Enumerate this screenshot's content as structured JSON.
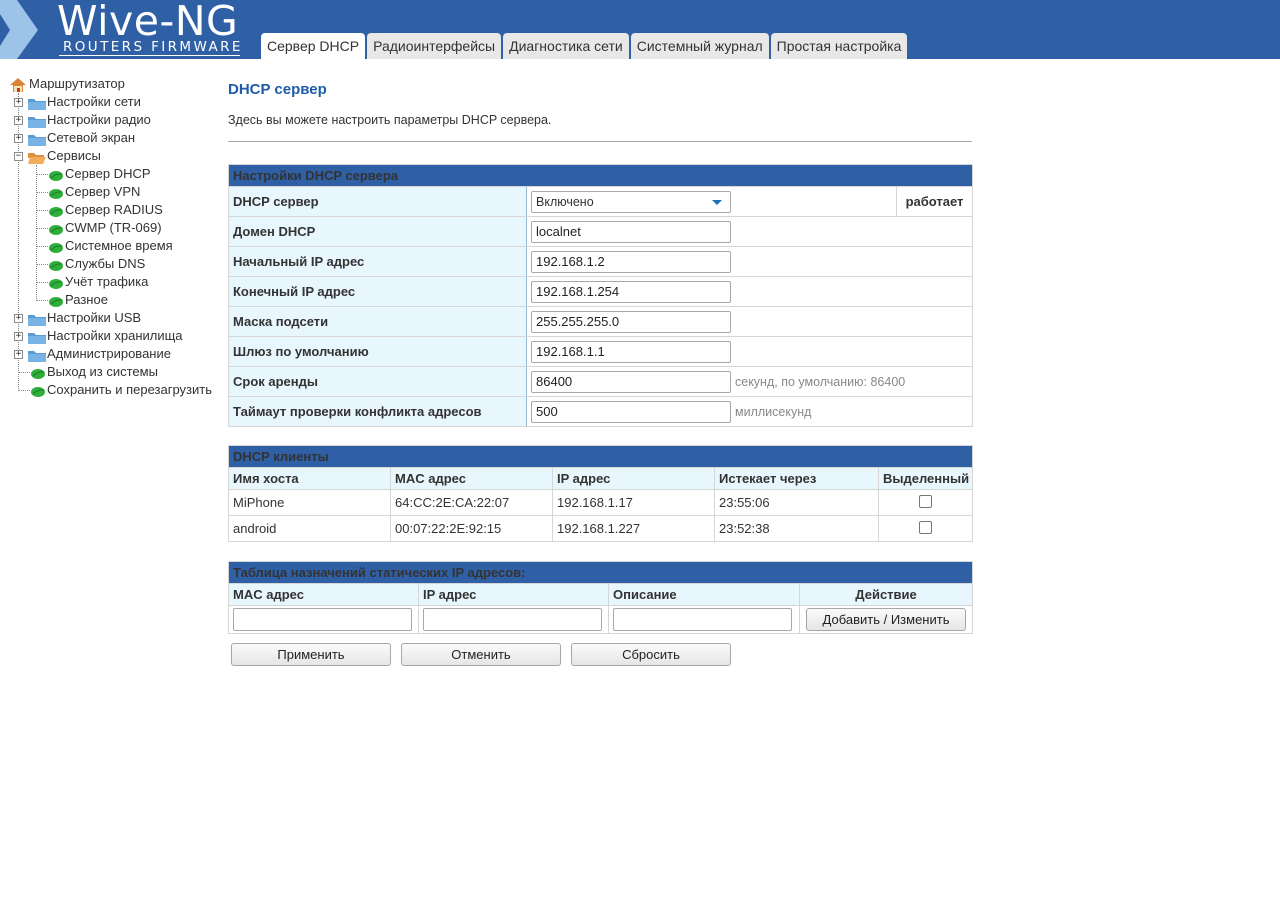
{
  "brand": {
    "title": "Wive-NG",
    "subtitle": "ROUTERS FIRMWARE"
  },
  "colors": {
    "header": "#2f5fa5",
    "accent": "#1d5ba8",
    "status_ok": "#4a9a2a",
    "label_bg": "#e8f6fd"
  },
  "tabs": [
    {
      "label": "Сервер DHCP",
      "active": true
    },
    {
      "label": "Радиоинтерфейсы",
      "active": false
    },
    {
      "label": "Диагностика сети",
      "active": false
    },
    {
      "label": "Системный журнал",
      "active": false
    },
    {
      "label": "Простая настройка",
      "active": false
    }
  ],
  "tree": {
    "root": {
      "label": "Маршрутизатор",
      "icon": "house-icon"
    },
    "items": [
      {
        "label": "Настройки сети",
        "icon": "folder-icon",
        "expanded": false
      },
      {
        "label": "Настройки радио",
        "icon": "folder-icon",
        "expanded": false
      },
      {
        "label": "Сетевой экран",
        "icon": "folder-icon",
        "expanded": false
      },
      {
        "label": "Сервисы",
        "icon": "folder-open-icon",
        "expanded": true,
        "children": [
          {
            "label": "Сервер DHCP"
          },
          {
            "label": "Сервер VPN"
          },
          {
            "label": "Сервер RADIUS"
          },
          {
            "label": "CWMP (TR-069)"
          },
          {
            "label": "Системное время"
          },
          {
            "label": "Службы DNS"
          },
          {
            "label": "Учёт трафика"
          },
          {
            "label": "Разное"
          }
        ]
      },
      {
        "label": "Настройки USB",
        "icon": "folder-icon",
        "expanded": false
      },
      {
        "label": "Настройки хранилища",
        "icon": "folder-icon",
        "expanded": false
      },
      {
        "label": "Администрирование",
        "icon": "folder-icon",
        "expanded": false
      },
      {
        "label": "Выход из системы",
        "icon": "leaf-icon"
      },
      {
        "label": "Сохранить и перезагрузить",
        "icon": "leaf-icon"
      }
    ]
  },
  "page": {
    "title": "DHCP сервер",
    "description": "Здесь вы можете настроить параметры DHCP сервера."
  },
  "settings": {
    "title": "Настройки DHCP сервера",
    "dhcp_server": {
      "label": "DHCP сервер",
      "value": "Включено",
      "status": "работает"
    },
    "domain": {
      "label": "Домен DHCP",
      "value": "localnet"
    },
    "start_ip": {
      "label": "Начальный IP адрес",
      "value": "192.168.1.2"
    },
    "end_ip": {
      "label": "Конечный IP адрес",
      "value": "192.168.1.254"
    },
    "netmask": {
      "label": "Маска подсети",
      "value": "255.255.255.0"
    },
    "gateway": {
      "label": "Шлюз по умолчанию",
      "value": "192.168.1.1"
    },
    "lease": {
      "label": "Срок аренды",
      "value": "86400",
      "hint": "секунд, по умолчанию: 86400"
    },
    "conflict_timeout": {
      "label": "Таймаут проверки конфликта адресов",
      "value": "500",
      "hint": "миллисекунд"
    }
  },
  "clients": {
    "title": "DHCP клиенты",
    "columns": [
      "Имя хоста",
      "MAC адрес",
      "IP адрес",
      "Истекает через",
      "Выделенный"
    ],
    "rows": [
      {
        "host": "MiPhone",
        "mac": "64:CC:2E:CA:22:07",
        "ip": "192.168.1.17",
        "expires": "23:55:06",
        "reserved": false
      },
      {
        "host": "android",
        "mac": "00:07:22:2E:92:15",
        "ip": "192.168.1.227",
        "expires": "23:52:38",
        "reserved": false
      }
    ]
  },
  "static": {
    "title": "Таблица назначений статических IP адресов:",
    "columns": [
      "MAC адрес",
      "IP адрес",
      "Описание",
      "Действие"
    ],
    "add_label": "Добавить / Изменить"
  },
  "actions": {
    "apply": "Применить",
    "cancel": "Отменить",
    "reset": "Сбросить"
  }
}
